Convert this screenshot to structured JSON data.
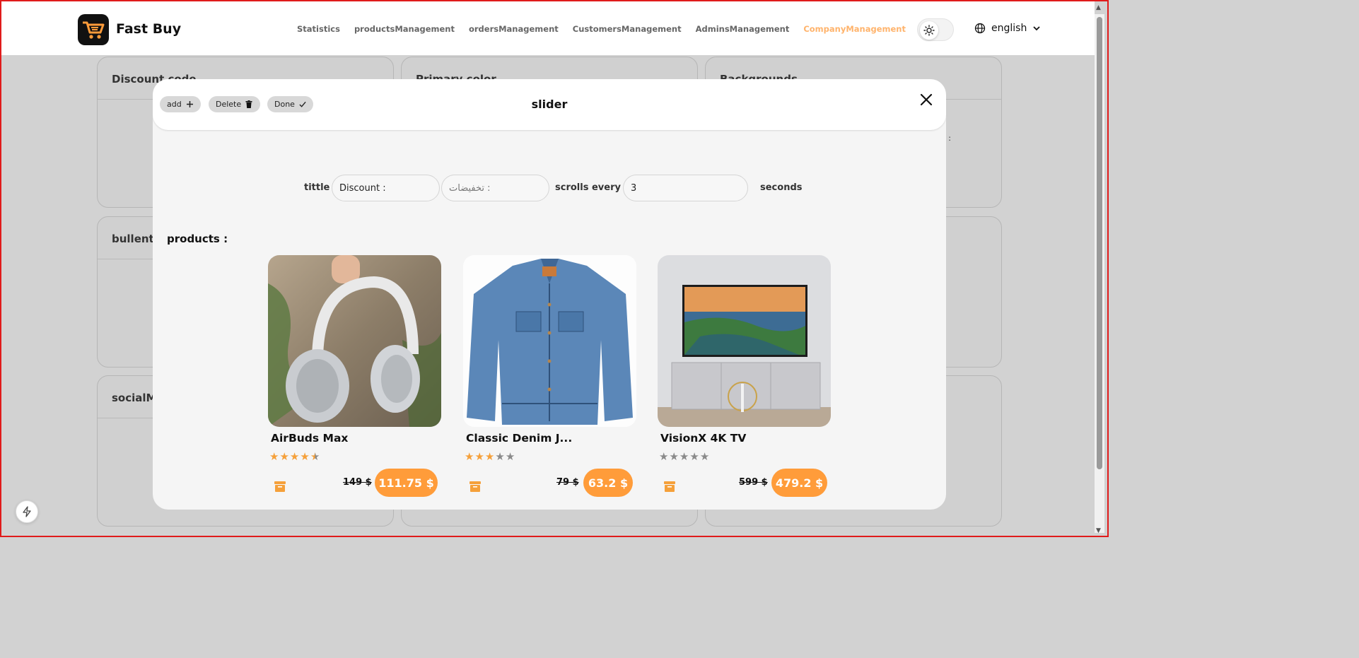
{
  "brand": {
    "name": "Fast Buy",
    "logo": "cart-logo-icon"
  },
  "nav": {
    "items": [
      {
        "label": "Statistics",
        "active": false
      },
      {
        "label": "productsManagement",
        "active": false
      },
      {
        "label": "ordersManagement",
        "active": false
      },
      {
        "label": "CustomersManagement",
        "active": false
      },
      {
        "label": "AdminsManagement",
        "active": false
      },
      {
        "label": "CompanyManagement",
        "active": true
      }
    ]
  },
  "header": {
    "theme_icon": "sun-icon",
    "language": "english"
  },
  "background_cards": {
    "discount_code": "Discount code",
    "primary_color": "Primary color",
    "backgrounds": "Backgrounds",
    "bulletin": "bullentin",
    "social_media": "socialMe",
    "partial_text": "s :"
  },
  "modal": {
    "title": "slider",
    "buttons": {
      "add": "add",
      "delete": "Delete",
      "done": "Done"
    },
    "title_label": "tittle",
    "title_en_value": "Discount :",
    "title_ar_value": "تخفيضات :",
    "scrolls_label": "scrolls every",
    "scroll_seconds_value": "3",
    "seconds_label": "seconds",
    "products_label": "products :"
  },
  "products": [
    {
      "name": "AirBuds Max",
      "rating": 4.5,
      "old_price": "149 $",
      "new_price": "111.75 $"
    },
    {
      "name": "Classic Denim J...",
      "rating": 3,
      "old_price": "79 $",
      "new_price": "63.2 $"
    },
    {
      "name": "VisionX 4K TV",
      "rating": 0,
      "old_price": "599 $",
      "new_price": "479.2 $"
    }
  ],
  "colors": {
    "accent": "#ff9c3a",
    "active_nav": "#ffb36b",
    "star_on": "#f5a03a",
    "star_off": "#8a8a8a"
  }
}
